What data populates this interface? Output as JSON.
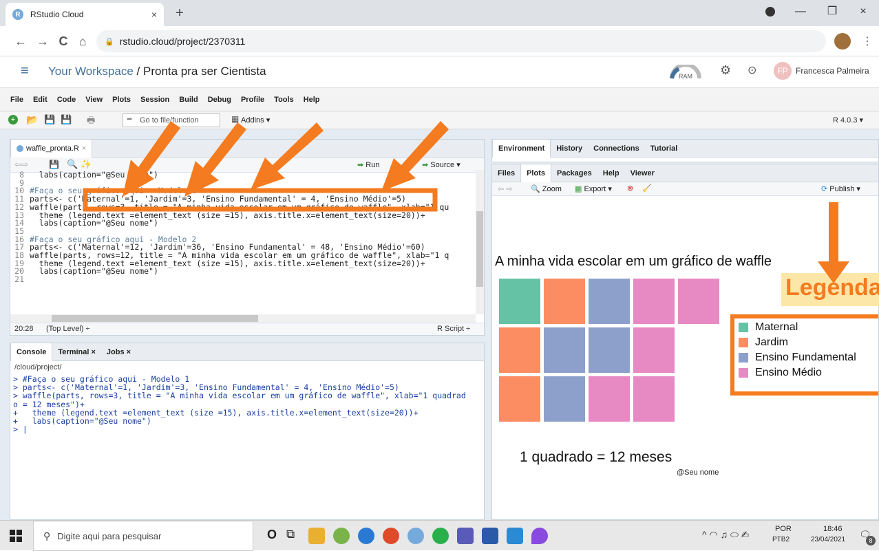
{
  "browser": {
    "tab_title": "RStudio Cloud",
    "tab_close": "×",
    "new_tab": "+",
    "url": "rstudio.cloud/project/2370311",
    "back": "←",
    "forward": "→",
    "reload": "C",
    "home": "⌂",
    "win_minimize": "—",
    "win_restore": "❐",
    "win_close": "×"
  },
  "header": {
    "menu_icon": "≡",
    "workspace": "Your Workspace",
    "separator": "/",
    "project": "Pronta pra ser Cientista",
    "ram": "RAM",
    "avatar_initials": "FP",
    "user": "Francesca Palmeira"
  },
  "menubar": [
    "File",
    "Edit",
    "Code",
    "View",
    "Plots",
    "Session",
    "Build",
    "Debug",
    "Profile",
    "Tools",
    "Help"
  ],
  "toolbar": {
    "goto_placeholder": "Go to file/function",
    "addins": "Addins ▾",
    "r_version": "R 4.0.3 ▾"
  },
  "editor": {
    "tab": "waffle_pronta.R",
    "run": "Run",
    "source": "Source ▾",
    "status_pos": "20:28",
    "status_scope": "(Top Level) ÷",
    "status_type": "R Script ÷",
    "lines": [
      {
        "n": "8",
        "t": "  labs(caption=\"@Seu nome\")"
      },
      {
        "n": "9",
        "t": ""
      },
      {
        "n": "10",
        "t": "#Faça o seu gráfico aqui - Modelo 1"
      },
      {
        "n": "11",
        "t": "parts<- c('Maternal'=1, 'Jardim'=3, 'Ensino Fundamental' = 4, 'Ensino Médio'=5)"
      },
      {
        "n": "12",
        "t": "waffle(parts, rows=3, title = \"A minha vida escolar em um gráfico de waffle\", xlab=\"1 qu"
      },
      {
        "n": "13",
        "t": "  theme (legend.text =element_text (size =15), axis.title.x=element_text(size=20))+"
      },
      {
        "n": "14",
        "t": "  labs(caption=\"@Seu nome\")"
      },
      {
        "n": "15",
        "t": ""
      },
      {
        "n": "16",
        "t": "#Faça o seu gráfico aqui - Modelo 2"
      },
      {
        "n": "17",
        "t": "parts<- c('Maternal'=12, 'Jardim'=36, 'Ensino Fundamental' = 48, 'Ensino Médio'=60)"
      },
      {
        "n": "18",
        "t": "waffle(parts, rows=12, title = \"A minha vida escolar em um gráfico de waffle\", xlab=\"1 q"
      },
      {
        "n": "19",
        "t": "  theme (legend.text =element_text (size =15), axis.title.x=element_text(size=20))+"
      },
      {
        "n": "20",
        "t": "  labs(caption=\"@Seu nome\")"
      },
      {
        "n": "21",
        "t": ""
      }
    ]
  },
  "console": {
    "tabs": [
      "Console",
      "Terminal ×",
      "Jobs ×"
    ],
    "path": "/cloud/project/",
    "lines": [
      "> #Faça o seu gráfico aqui - Modelo 1",
      "> parts<- c('Maternal'=1, 'Jardim'=3, 'Ensino Fundamental' = 4, 'Ensino Médio'=5)",
      "> waffle(parts, rows=3, title = \"A minha vida escolar em um gráfico de waffle\", xlab=\"1 quadrad",
      "o = 12 meses\")+",
      "+   theme (legend.text =element_text (size =15), axis.title.x=element_text(size=20))+",
      "+   labs(caption=\"@Seu nome\")",
      "> |"
    ]
  },
  "env_pane": {
    "tabs": [
      "Environment",
      "History",
      "Connections",
      "Tutorial"
    ]
  },
  "plots_pane": {
    "tabs": [
      "Files",
      "Plots",
      "Packages",
      "Help",
      "Viewer"
    ],
    "zoom": "Zoom",
    "export": "Export ▾",
    "publish": "Publish ▾"
  },
  "chart_data": {
    "type": "waffle",
    "title": "A minha vida escolar em um gráfico de waffle",
    "xlabel": "1 quadrado = 12 meses",
    "caption": "@Seu nome",
    "rows": 3,
    "categories": [
      "Maternal",
      "Jardim",
      "Ensino Fundamental",
      "Ensino Médio"
    ],
    "values": [
      1,
      3,
      4,
      5
    ],
    "colors": [
      "#66c2a5",
      "#fc8d62",
      "#8da0cb",
      "#e78ac3"
    ],
    "legend_position": "right"
  },
  "annotation": {
    "legend_label": "Legenda",
    "accent": "#f47b20"
  },
  "taskbar": {
    "search_placeholder": "Digite aqui para pesquisar",
    "lang1": "POR",
    "lang2": "PTB2",
    "time": "18:46",
    "date": "23/04/2021",
    "notif": "8"
  }
}
